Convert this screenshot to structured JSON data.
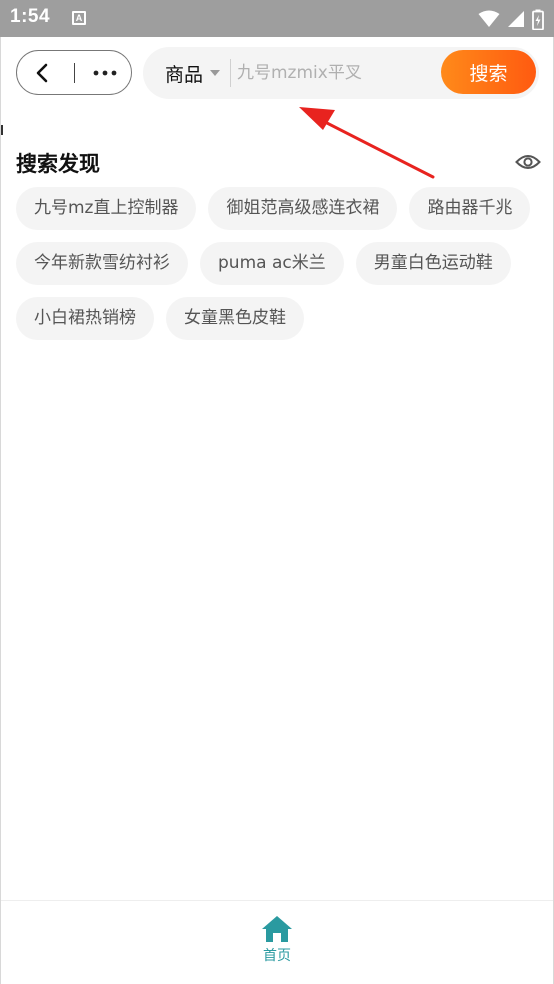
{
  "status_bar": {
    "time": "1:54",
    "notification_glyph": "A",
    "icons": [
      "wifi-icon",
      "signal-icon",
      "battery-icon"
    ]
  },
  "nav": {
    "back_icon": "chevron-left-icon",
    "more_icon": "more-dots-icon"
  },
  "search": {
    "category_label": "商品",
    "category_icon": "caret-down-icon",
    "placeholder": "九号mzmix平叉",
    "button_label": "搜索"
  },
  "discover": {
    "title": "搜索发现",
    "visibility_icon": "eye-icon",
    "tags": [
      "九号mz直上控制器",
      "御姐范高级感连衣裙",
      "路由器千兆",
      "今年新款雪纺衬衫",
      "puma ac米兰",
      "男童白色运动鞋",
      "小白裙热销榜",
      "女童黑色皮鞋"
    ]
  },
  "tab_bar": {
    "home_label": "首页",
    "home_icon": "home-icon"
  },
  "colors": {
    "status_bar": "#9e9e9e",
    "accent_orange": "#ff6a14",
    "tab_active": "#2a9aa0",
    "annotation_arrow": "#e8231f"
  }
}
